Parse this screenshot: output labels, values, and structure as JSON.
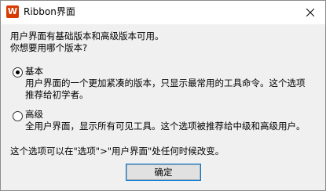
{
  "window": {
    "icon_letter": "W",
    "title": "Ribbon界面"
  },
  "intro": {
    "line1": "用户界面有基础版本和高级版本可用。",
    "line2": "你想要用哪个版本?"
  },
  "options": [
    {
      "label": "基本",
      "selected": true,
      "desc_line1": "用户界面的一个更加紧凑的版本，只显示最常用的工具命令。这个选项",
      "desc_line2": "推荐给初学者。"
    },
    {
      "label": "高级",
      "selected": false,
      "desc_line1": "全用户界面，显示所有可见工具。这个选项被推荐给中级和高级用户。"
    }
  ],
  "footer_note": "这个选项可以在\"选项\">\"用户界面\"处任何时候改变。",
  "ok_label": "确定"
}
